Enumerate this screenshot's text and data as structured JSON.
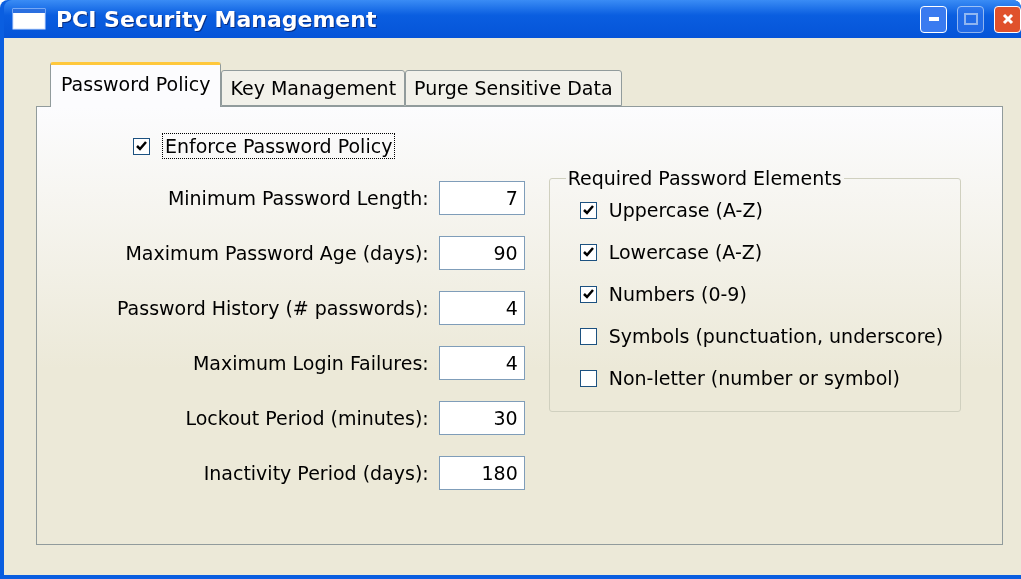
{
  "window": {
    "title": "PCI Security Management",
    "maximize_disabled": true
  },
  "tabs": [
    {
      "label": "Password Policy",
      "selected": true
    },
    {
      "label": "Key Management",
      "selected": false
    },
    {
      "label": "Purge Sensitive Data",
      "selected": false
    }
  ],
  "enforce": {
    "label": "Enforce Password Policy",
    "checked": true
  },
  "fields": [
    {
      "label": "Minimum Password Length:",
      "value": "7"
    },
    {
      "label": "Maximum Password Age (days):",
      "value": "90"
    },
    {
      "label": "Password History (# passwords):",
      "value": "4"
    },
    {
      "label": "Maximum Login Failures:",
      "value": "4"
    },
    {
      "label": "Lockout Period (minutes):",
      "value": "30"
    },
    {
      "label": "Inactivity Period (days):",
      "value": "180"
    }
  ],
  "required_elements": {
    "title": "Required Password Elements",
    "items": [
      {
        "label": "Uppercase (A-Z)",
        "checked": true
      },
      {
        "label": "Lowercase (A-Z)",
        "checked": true
      },
      {
        "label": "Numbers (0-9)",
        "checked": true
      },
      {
        "label": "Symbols (punctuation, underscore)",
        "checked": false
      },
      {
        "label": "Non-letter (number or symbol)",
        "checked": false
      }
    ]
  }
}
